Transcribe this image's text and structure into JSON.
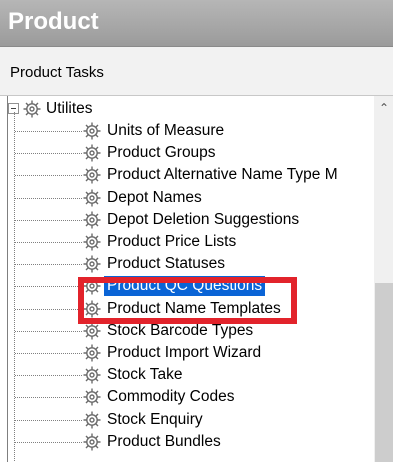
{
  "window": {
    "title": "Product"
  },
  "panel": {
    "header": "Product Tasks"
  },
  "tree": {
    "root": {
      "label": "Utilites",
      "expanded": true
    },
    "items": [
      {
        "label": "Units of Measure"
      },
      {
        "label": "Product Groups"
      },
      {
        "label": "Product Alternative Name Type M"
      },
      {
        "label": "Depot Names"
      },
      {
        "label": "Depot Deletion Suggestions"
      },
      {
        "label": "Product Price Lists"
      },
      {
        "label": "Product Statuses"
      },
      {
        "label": "Product QC Questions",
        "selected": true
      },
      {
        "label": "Product Name Templates"
      },
      {
        "label": "Stock Barcode Types"
      },
      {
        "label": "Product Import Wizard"
      },
      {
        "label": "Stock Take"
      },
      {
        "label": "Commodity Codes"
      },
      {
        "label": "Stock Enquiry"
      },
      {
        "label": "Product Bundles"
      }
    ]
  },
  "colors": {
    "selection": "#0a64d6",
    "highlight_box": "#e2232b",
    "title_bar": "#a8a8a8"
  },
  "icons": {
    "item": "gear-icon",
    "expander": "collapse-icon",
    "scroll_up": "scroll-up-arrow-icon"
  }
}
